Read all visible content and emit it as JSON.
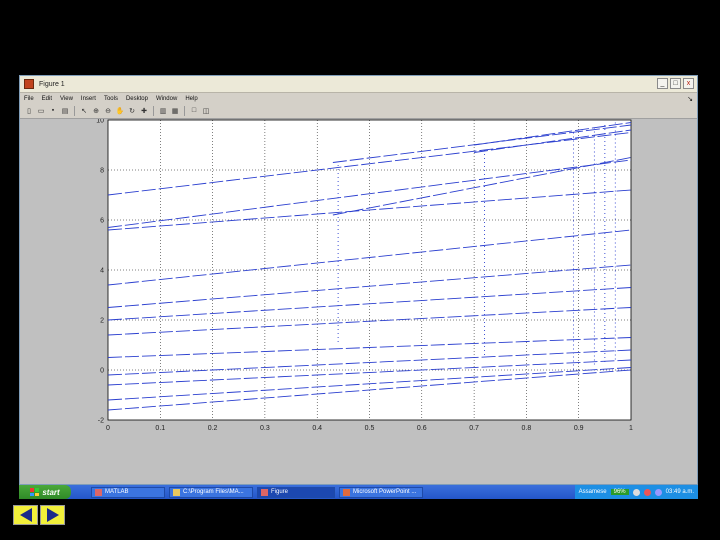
{
  "window": {
    "title": "Figure 1",
    "controls": [
      "_",
      "□",
      "x"
    ],
    "dock_arrow": "↘"
  },
  "menu": [
    "File",
    "Edit",
    "View",
    "Insert",
    "Tools",
    "Desktop",
    "Window",
    "Help"
  ],
  "toolbar_icons": [
    "new-icon",
    "open-icon",
    "save-icon",
    "print-icon",
    "select-arrow-icon",
    "zoom-in-icon",
    "zoom-out-icon",
    "pan-icon",
    "rotate-icon",
    "data-cursor-icon",
    "colorbar-icon",
    "legend-icon",
    "hide-plot-tools-icon",
    "show-plot-tools-icon"
  ],
  "colors": {
    "line": "#2b3fcf",
    "grid": "#000000",
    "plot_bg": "#ffffff",
    "figure_bg": "#c0c0c0"
  },
  "chart_data": {
    "type": "line",
    "title": "",
    "xlabel": "",
    "ylabel": "",
    "xlim": [
      0,
      1
    ],
    "ylim": [
      -2,
      10
    ],
    "grid": true,
    "xticks": [
      "0",
      "0.1",
      "0.2",
      "0.3",
      "0.4",
      "0.5",
      "0.6",
      "0.7",
      "0.8",
      "0.9",
      "1"
    ],
    "yticks": [
      "10",
      "8",
      "6",
      "4",
      "2",
      "0",
      "-2"
    ],
    "series": [
      {
        "x": [
          0,
          1
        ],
        "y": [
          7.0,
          9.5
        ],
        "style": "dashed"
      },
      {
        "x": [
          0,
          1
        ],
        "y": [
          5.7,
          8.4
        ],
        "style": "dashed"
      },
      {
        "x": [
          0,
          1
        ],
        "y": [
          5.6,
          7.2
        ],
        "style": "dashed"
      },
      {
        "x": [
          0,
          1
        ],
        "y": [
          3.4,
          5.6
        ],
        "style": "dashed"
      },
      {
        "x": [
          0,
          1
        ],
        "y": [
          2.5,
          4.2
        ],
        "style": "dashed"
      },
      {
        "x": [
          0,
          1
        ],
        "y": [
          2.0,
          3.3
        ],
        "style": "dashed"
      },
      {
        "x": [
          0,
          1
        ],
        "y": [
          1.4,
          2.5
        ],
        "style": "dashed"
      },
      {
        "x": [
          0,
          1
        ],
        "y": [
          0.5,
          1.3
        ],
        "style": "dashed"
      },
      {
        "x": [
          0,
          1
        ],
        "y": [
          -0.2,
          0.8
        ],
        "style": "dashed"
      },
      {
        "x": [
          0,
          1
        ],
        "y": [
          -0.6,
          0.4
        ],
        "style": "dashed"
      },
      {
        "x": [
          0,
          1
        ],
        "y": [
          -1.2,
          0.1
        ],
        "style": "dashed"
      },
      {
        "x": [
          0,
          1
        ],
        "y": [
          -1.6,
          0.0
        ],
        "style": "dashed"
      },
      {
        "x": [
          0.43,
          1
        ],
        "y": [
          8.3,
          9.8
        ],
        "style": "dashed"
      },
      {
        "x": [
          0.43,
          1
        ],
        "y": [
          6.2,
          8.5
        ],
        "style": "dashed"
      },
      {
        "x": [
          0.7,
          1
        ],
        "y": [
          9.0,
          9.9
        ],
        "style": "dashed"
      },
      {
        "x": [
          0.7,
          1
        ],
        "y": [
          8.7,
          9.6
        ],
        "style": "dashed"
      },
      {
        "x": [
          0.44,
          0.44
        ],
        "y": [
          8.2,
          1.0
        ],
        "style": "dotted"
      },
      {
        "x": [
          0.72,
          0.72
        ],
        "y": [
          8.8,
          0.5
        ],
        "style": "dotted"
      },
      {
        "x": [
          0.89,
          0.89
        ],
        "y": [
          9.5,
          0.0
        ],
        "style": "dotted"
      },
      {
        "x": [
          0.93,
          0.93
        ],
        "y": [
          9.7,
          0.2
        ],
        "style": "dotted"
      },
      {
        "x": [
          0.95,
          0.95
        ],
        "y": [
          9.8,
          0.3
        ],
        "style": "dotted"
      },
      {
        "x": [
          0.97,
          0.97
        ],
        "y": [
          9.9,
          0.4
        ],
        "style": "dotted"
      }
    ]
  },
  "taskbar": {
    "start_label": "start",
    "tasks": [
      {
        "label": "MATLAB",
        "icon": "matlab-icon"
      },
      {
        "label": "C:\\Program Files\\MA...",
        "icon": "folder-icon"
      },
      {
        "label": "Figure",
        "icon": "figure-icon"
      },
      {
        "label": "Microsoft PowerPoint ...",
        "icon": "powerpoint-icon"
      }
    ],
    "tray_lang": "Assamese",
    "tray_percent": "96%",
    "clock": "03:49 a.m."
  }
}
